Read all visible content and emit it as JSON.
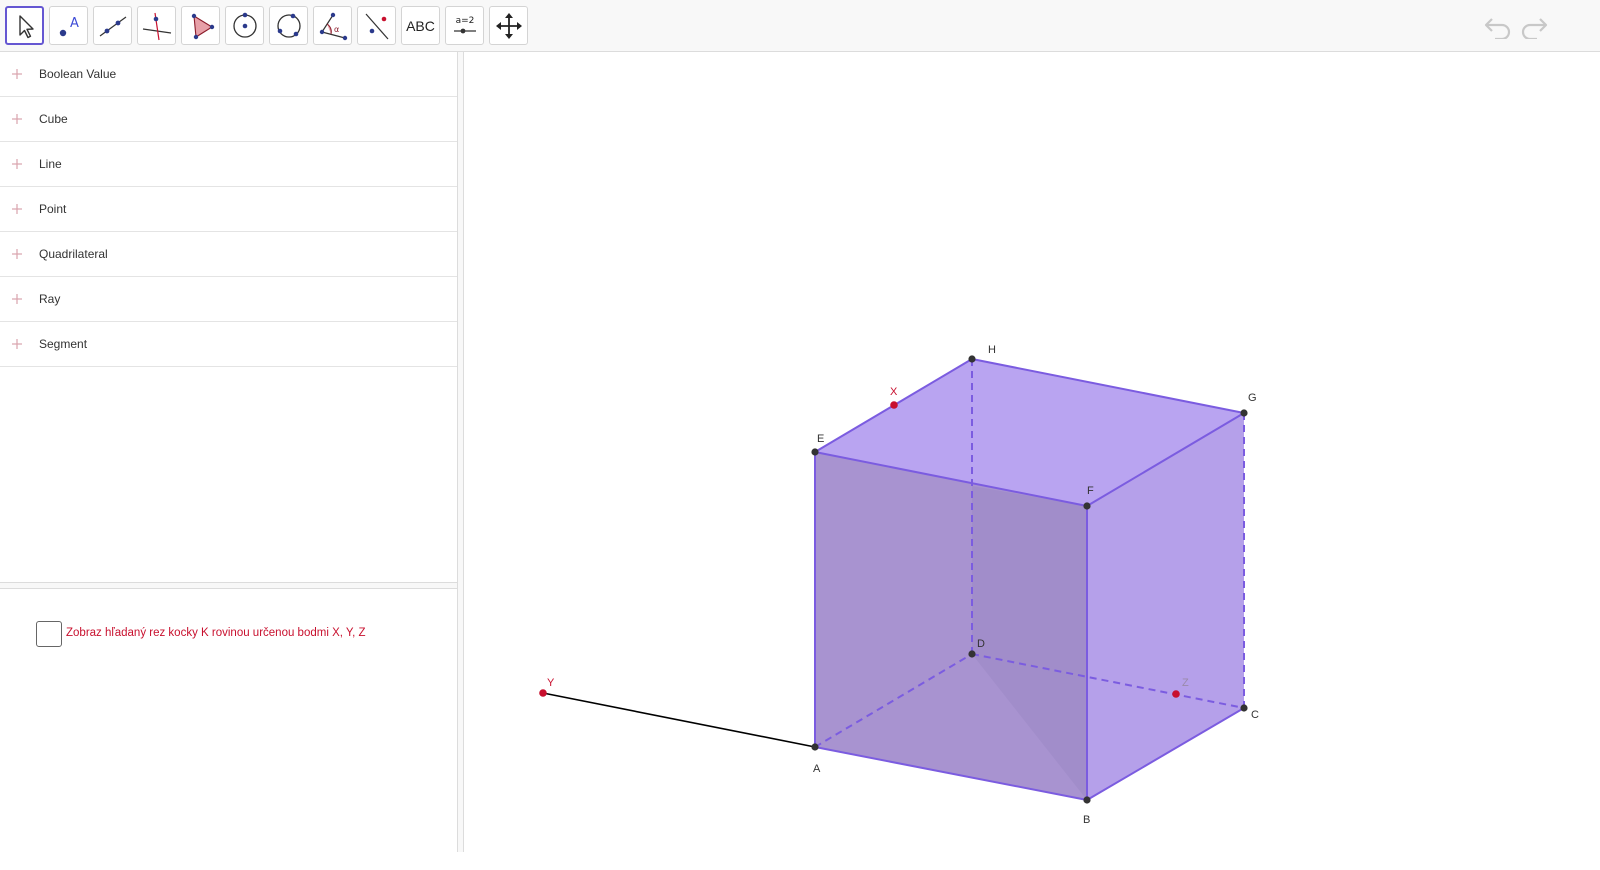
{
  "toolbar": {
    "tools": [
      {
        "name": "move-tool",
        "icon": "arrow-pointer-icon"
      },
      {
        "name": "point-tool",
        "icon": "point-icon",
        "glyph": "A"
      },
      {
        "name": "line-tool",
        "icon": "line-through-points-icon"
      },
      {
        "name": "perpendicular-line-tool",
        "icon": "perpendicular-line-icon"
      },
      {
        "name": "polygon-tool",
        "icon": "polygon-icon"
      },
      {
        "name": "circle-tool",
        "icon": "circle-center-point-icon"
      },
      {
        "name": "circle-three-points-tool",
        "icon": "circle-three-points-icon"
      },
      {
        "name": "angle-tool",
        "icon": "angle-icon",
        "glyph": "α"
      },
      {
        "name": "reflect-tool",
        "icon": "reflect-about-line-icon"
      },
      {
        "name": "text-tool",
        "icon": "text-icon",
        "label": "ABC"
      },
      {
        "name": "slider-tool",
        "icon": "slider-icon",
        "label": "a=2"
      },
      {
        "name": "move-graphics-tool",
        "icon": "move-view-icon"
      }
    ],
    "undo_icon": "undo-icon",
    "redo_icon": "redo-icon"
  },
  "algebra": {
    "groups": [
      "Boolean Value",
      "Cube",
      "Line",
      "Point",
      "Quadrilateral",
      "Ray",
      "Segment"
    ]
  },
  "checkbox": {
    "checked": false,
    "label": "Zobraz hľadaný rez kocky K rovinou určenou bodmi X, Y, Z"
  },
  "graphics": {
    "points": {
      "A": {
        "label": "A"
      },
      "B": {
        "label": "B"
      },
      "C": {
        "label": "C"
      },
      "D": {
        "label": "D"
      },
      "E": {
        "label": "E"
      },
      "F": {
        "label": "F"
      },
      "G": {
        "label": "G"
      },
      "H": {
        "label": "H"
      },
      "X": {
        "label": "X"
      },
      "Y": {
        "label": "Y"
      },
      "Z": {
        "label": "Z"
      }
    },
    "colors": {
      "cube_face": "#9b79e6",
      "cube_edge": "#7b5ce0",
      "vertex": "#333333",
      "special_point": "#c8102e",
      "segment": "#000000"
    }
  }
}
